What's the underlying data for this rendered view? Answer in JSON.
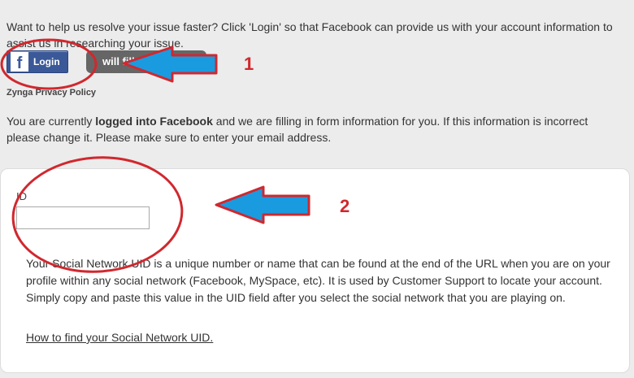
{
  "intro_text": "Want to help us resolve your issue faster? Click 'Login' so that Facebook can provide us with your account information to assist us in researching your issue.",
  "login_button": {
    "icon": "facebook-f-icon",
    "icon_glyph": "f",
    "label": "Login"
  },
  "fill_button": {
    "label": "will fill"
  },
  "privacy_link": "Zynga Privacy Policy",
  "status": {
    "part1": "You are currently ",
    "bold": "logged into Facebook",
    "part2": " and we are filling in form information for you. If this information is incorrect please change it. Please make sure to enter your email address."
  },
  "form": {
    "id_label": "ID",
    "id_value": ""
  },
  "uid_help_text": "Your Social Network UID is a unique number or name that can be found at the end of the URL when you are on your profile within any social network (Facebook, MySpace, etc). It is used by Customer Support to locate your account. Simply copy and paste this value in the UID field after you select the social network that you are playing on.",
  "uid_help_link": "How to find your Social Network UID.",
  "annotations": {
    "marker_1": "1",
    "marker_2": "2",
    "color_red": "#d0282e",
    "color_arrow": "#1a9be0"
  }
}
